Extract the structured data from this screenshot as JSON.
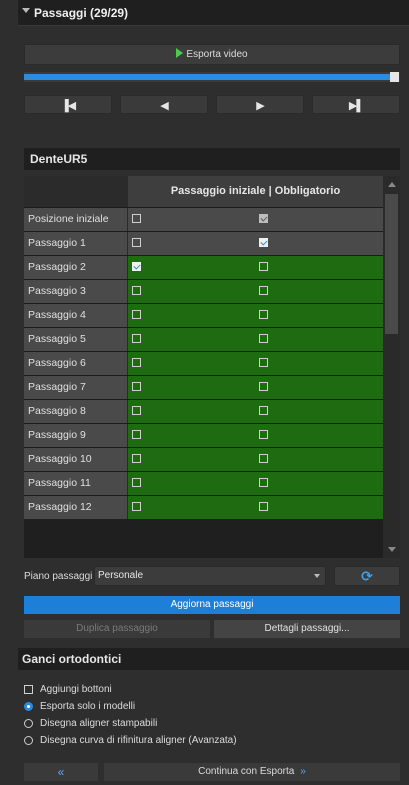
{
  "section": {
    "title": "Passaggi (29/29)"
  },
  "toolbar": {
    "export_video": "Esporta video"
  },
  "progress": {
    "value_fraction": 0.98
  },
  "transport": {
    "first": "▐◀",
    "prev": "◀",
    "next": "▶",
    "last": "▶▌"
  },
  "dente": {
    "title": "DenteUR5"
  },
  "table": {
    "header": "Passaggio iniziale | Obbligatorio",
    "rows": [
      {
        "label": "Posizione iniziale",
        "col1": false,
        "col2": "checked-disabled",
        "fill": "#4a4a4a"
      },
      {
        "label": "Passaggio 1",
        "col1": false,
        "col2": true,
        "fill": "#4a4a4a"
      },
      {
        "label": "Passaggio 2",
        "col1": true,
        "col2": false,
        "fill": "#1f6b12"
      },
      {
        "label": "Passaggio 3",
        "col1": false,
        "col2": false,
        "fill": "#1f6b12"
      },
      {
        "label": "Passaggio 4",
        "col1": false,
        "col2": false,
        "fill": "#1f6b12"
      },
      {
        "label": "Passaggio 5",
        "col1": false,
        "col2": false,
        "fill": "#1f6b12"
      },
      {
        "label": "Passaggio 6",
        "col1": false,
        "col2": false,
        "fill": "#1f6b12"
      },
      {
        "label": "Passaggio 7",
        "col1": false,
        "col2": false,
        "fill": "#1f6b12"
      },
      {
        "label": "Passaggio 8",
        "col1": false,
        "col2": false,
        "fill": "#1f6b12"
      },
      {
        "label": "Passaggio 9",
        "col1": false,
        "col2": false,
        "fill": "#1f6b12"
      },
      {
        "label": "Passaggio 10",
        "col1": false,
        "col2": false,
        "fill": "#1f6b12"
      },
      {
        "label": "Passaggio 11",
        "col1": false,
        "col2": false,
        "fill": "#1f6b12"
      },
      {
        "label": "Passaggio 12",
        "col1": false,
        "col2": false,
        "fill": "#1f6b12"
      }
    ]
  },
  "piano": {
    "label": "Piano passaggi",
    "value": "Personale"
  },
  "actions": {
    "aggiorna": "Aggiorna passaggi",
    "duplica": "Duplica passaggio",
    "dettagli": "Dettagli passaggi..."
  },
  "ganci": {
    "title": "Ganci ortodontici",
    "options": [
      {
        "type": "checkbox",
        "label": "Aggiungi bottoni",
        "checked": false
      },
      {
        "type": "radio",
        "label": "Esporta solo i modelli",
        "checked": true
      },
      {
        "type": "radio",
        "label": "Disegna aligner stampabili",
        "checked": false
      },
      {
        "type": "radio",
        "label": "Disegna curva di rifinitura aligner (Avanzata)",
        "checked": false
      }
    ]
  },
  "bottom": {
    "back": "«",
    "continue": "Continua con Esporta",
    "continue_chevron": "»"
  },
  "colors": {
    "accent": "#2a8be0",
    "row_green": "#1f6b12",
    "panel": "#2e2e2e"
  }
}
